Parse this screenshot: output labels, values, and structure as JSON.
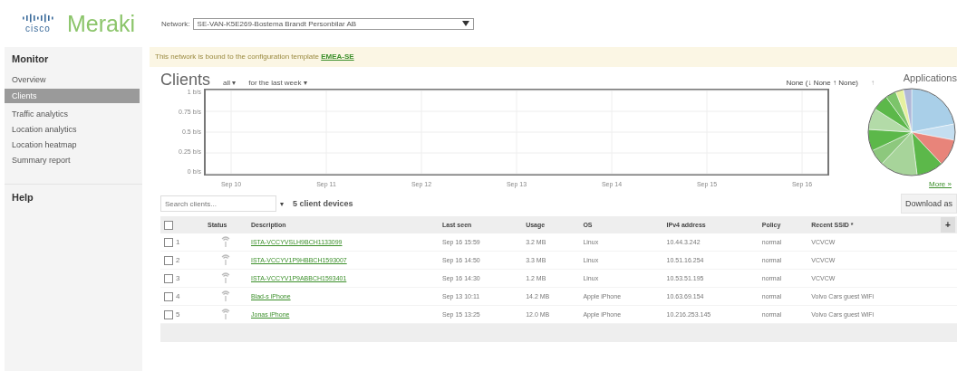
{
  "header": {
    "brand_small": "cisco",
    "brand": "Meraki",
    "network_label": "Network:",
    "network_value": "SE-VAN-K5E269-Bostema Brandt Personbilar AB"
  },
  "sidebar": {
    "sections": [
      {
        "title": "Monitor",
        "items": [
          {
            "label": "Overview",
            "selected": false
          },
          {
            "label": "Clients",
            "selected": true
          },
          {
            "label": "Traffic analytics",
            "selected": false
          },
          {
            "label": "Location analytics",
            "selected": false
          },
          {
            "label": "Location heatmap",
            "selected": false
          },
          {
            "label": "Summary report",
            "selected": false
          }
        ]
      },
      {
        "title": "Help"
      }
    ]
  },
  "banner": {
    "text": "This network is bound to the configuration template ",
    "link": "EMEA-SE"
  },
  "clients": {
    "title": "Clients",
    "filter": "all ▾",
    "period": "for the last week ▾",
    "legend": "None (↓ None ↑ None)",
    "legend_marker": "↑",
    "chart_data": {
      "type": "line",
      "grid": true,
      "categories": [
        "Sep 10",
        "Sep 11",
        "Sep 12",
        "Sep 13",
        "Sep 14",
        "Sep 15",
        "Sep 16"
      ],
      "ylim": [
        0,
        1
      ],
      "yticks": [
        {
          "value": 1,
          "label": "1 b/s"
        },
        {
          "value": 0.75,
          "label": "0.75 b/s"
        },
        {
          "value": 0.5,
          "label": "0.5 b/s"
        },
        {
          "value": 0.25,
          "label": "0.25 b/s"
        },
        {
          "value": 0,
          "label": "0 b/s"
        }
      ]
    }
  },
  "applications": {
    "title": "Applications",
    "more": "More »",
    "download": "Download as"
  },
  "search": {
    "placeholder": "Search clients...",
    "caret": "▾",
    "count": "5 client devices"
  },
  "table": {
    "columns": [
      "Status",
      "Description",
      "Last seen",
      "Usage",
      "OS",
      "IPv4 address",
      "Policy",
      "Recent SSID *"
    ],
    "add": "+",
    "all_checked": false,
    "rows": [
      {
        "checked": false,
        "index": "1",
        "description": "ISTA-VCCYVSLH9BCH1133099",
        "last_seen": "Sep 16 15:59",
        "usage": "3.2 MB",
        "os": "Linux",
        "ip": "10.44.3.242",
        "policy": "normal",
        "ssid": "VCVCW"
      },
      {
        "checked": false,
        "index": "2",
        "description": "ISTA-VCCYV1P9HBBCH1593007",
        "last_seen": "Sep 16 14:50",
        "usage": "3.3 MB",
        "os": "Linux",
        "ip": "10.51.16.254",
        "policy": "normal",
        "ssid": "VCVCW"
      },
      {
        "checked": false,
        "index": "3",
        "description": "ISTA-VCCYV1P9ABBCH1593401",
        "last_seen": "Sep 16 14:30",
        "usage": "1.2 MB",
        "os": "Linux",
        "ip": "10.53.51.195",
        "policy": "normal",
        "ssid": "VCVCW"
      },
      {
        "checked": false,
        "index": "4",
        "description": "Blad-s iPhone",
        "last_seen": "Sep 13 10:11",
        "usage": "14.2 MB",
        "os": "Apple iPhone",
        "ip": "10.63.69.154",
        "policy": "normal",
        "ssid": "Volvo Cars guest WiFi"
      },
      {
        "checked": false,
        "index": "5",
        "description": "Jonas iPhone",
        "last_seen": "Sep 15 13:25",
        "usage": "12.0 MB",
        "os": "Apple iPhone",
        "ip": "10.216.253.145",
        "policy": "normal",
        "ssid": "Volvo Cars guest WiFi"
      }
    ]
  }
}
